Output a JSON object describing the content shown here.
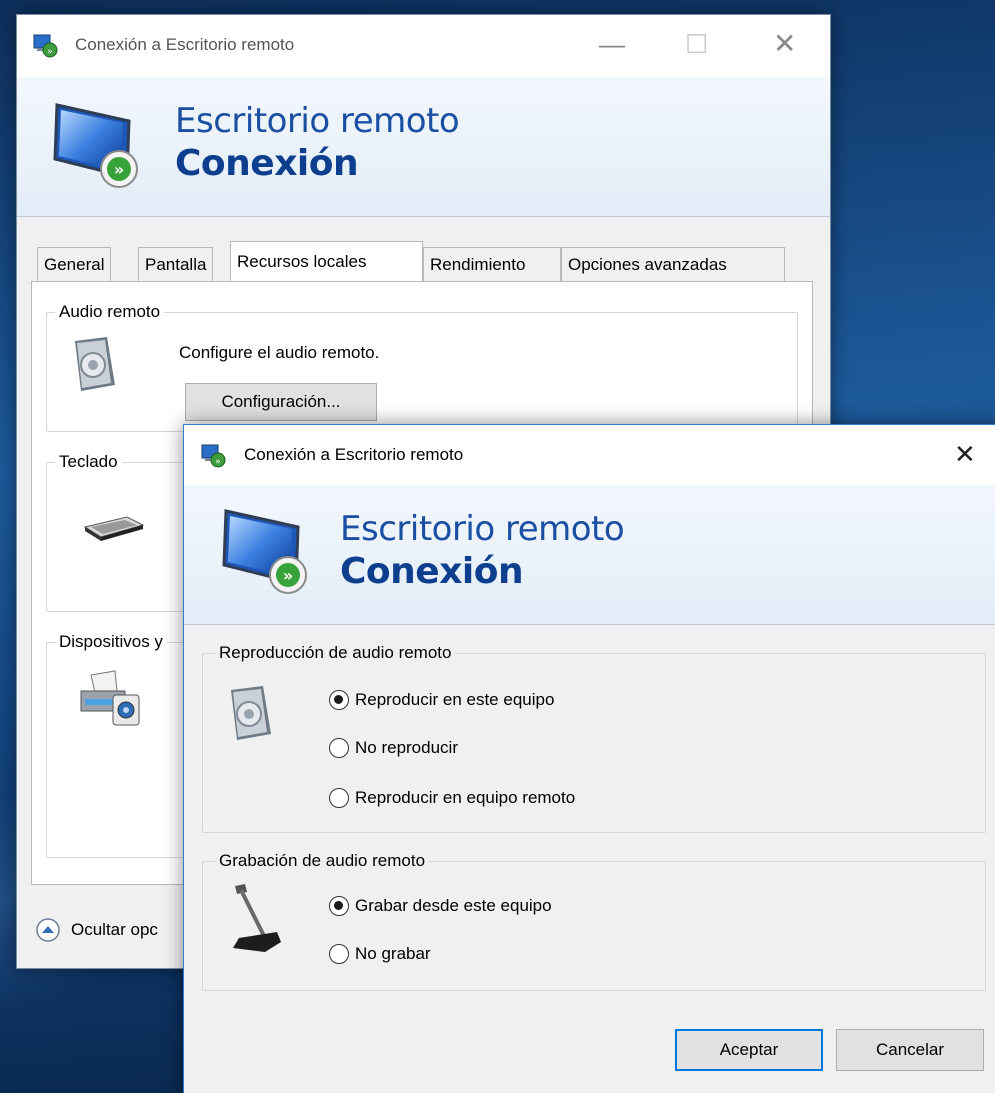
{
  "back_window": {
    "title": "Conexión a Escritorio remoto",
    "banner_line1": "Escritorio remoto",
    "banner_line2": "Conexión",
    "tabs": [
      {
        "label": "General"
      },
      {
        "label": "Pantalla"
      },
      {
        "label": "Recursos locales"
      },
      {
        "label": "Rendimiento"
      },
      {
        "label": "Opciones avanzadas"
      }
    ],
    "active_tab": "Recursos locales",
    "audio_group": {
      "label": "Audio remoto",
      "description": "Configure el audio remoto.",
      "button": "Configuración..."
    },
    "keyboard_group": {
      "label": "Teclado"
    },
    "devices_group": {
      "label": "Dispositivos y"
    },
    "hide_options": "Ocultar opc"
  },
  "dialog": {
    "title": "Conexión a Escritorio remoto",
    "close_glyph": "✕",
    "banner_line1": "Escritorio remoto",
    "banner_line2": "Conexión",
    "playback_group": {
      "label": "Reproducción de audio remoto",
      "options": [
        {
          "label": "Reproducir en este equipo",
          "checked": true
        },
        {
          "label": "No reproducir",
          "checked": false
        },
        {
          "label": "Reproducir en equipo remoto",
          "checked": false
        }
      ]
    },
    "recording_group": {
      "label": "Grabación de audio remoto",
      "options": [
        {
          "label": "Grabar desde este equipo",
          "checked": true
        },
        {
          "label": "No grabar",
          "checked": false
        }
      ]
    },
    "ok_button": "Aceptar",
    "cancel_button": "Cancelar"
  },
  "colors": {
    "accent": "#0078d7",
    "banner_text": "#1a4fa3"
  }
}
